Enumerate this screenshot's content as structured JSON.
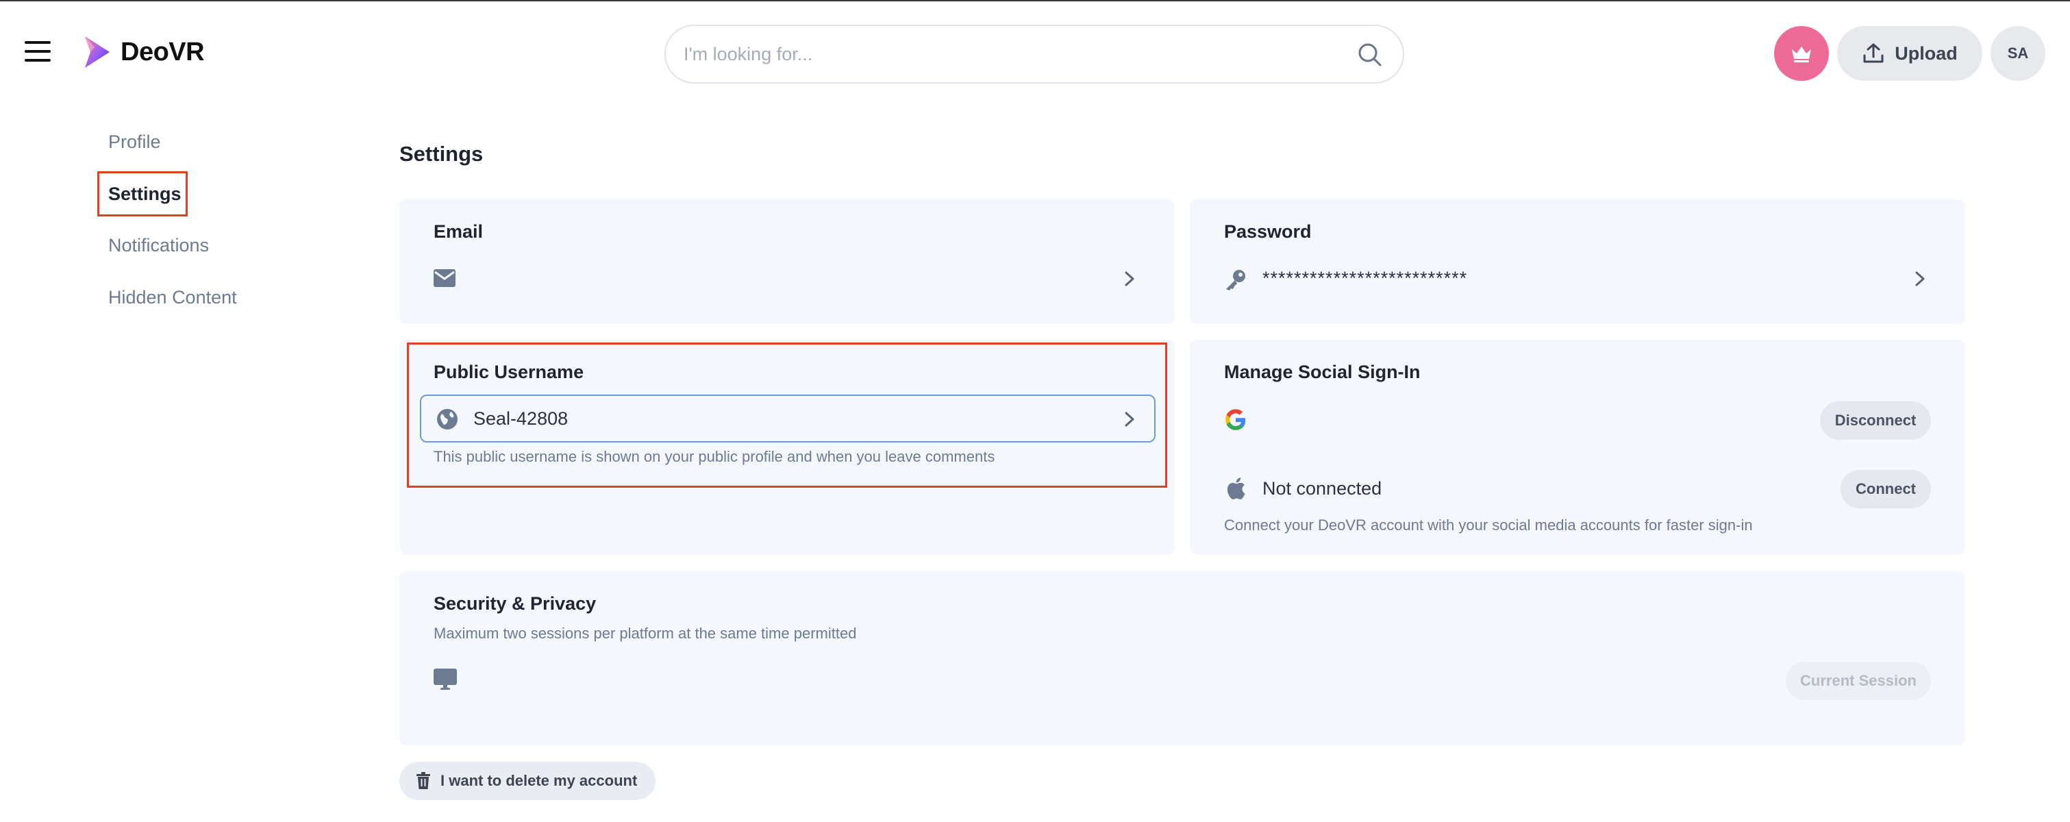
{
  "header": {
    "brand": "DeoVR",
    "search_placeholder": "I'm looking for...",
    "upload_label": "Upload",
    "avatar_initials": "SA",
    "colors": {
      "crown_bg": "#ee6b98",
      "button_bg": "#e8e9ed"
    }
  },
  "sidebar": {
    "items": [
      {
        "label": "Profile",
        "active": false
      },
      {
        "label": "Settings",
        "active": true
      },
      {
        "label": "Notifications",
        "active": false
      },
      {
        "label": "Hidden Content",
        "active": false
      }
    ]
  },
  "main": {
    "title": "Settings",
    "email": {
      "title": "Email",
      "icon": "envelope-icon"
    },
    "password": {
      "title": "Password",
      "masked_value": "**************************",
      "icon": "key-icon"
    },
    "username": {
      "title": "Public Username",
      "value": "Seal-42808",
      "help": "This public username is shown on your public profile and when you leave comments",
      "icon": "globe-icon"
    },
    "social": {
      "title": "Manage Social Sign-In",
      "google": {
        "button": "Disconnect",
        "icon": "google-icon"
      },
      "apple": {
        "status": "Not connected",
        "button": "Connect",
        "icon": "apple-icon"
      },
      "help": "Connect your DeoVR account with your social media accounts for faster sign-in"
    },
    "security": {
      "title": "Security & Privacy",
      "help": "Maximum two sessions per platform at the same time permitted",
      "session_button": "Current Session",
      "icon": "monitor-icon"
    },
    "delete_label": "I want to delete my account",
    "colors": {
      "card_bg": "#f4f7fc",
      "highlight_red": "#e0402a",
      "input_border": "#6f9ad8"
    }
  }
}
